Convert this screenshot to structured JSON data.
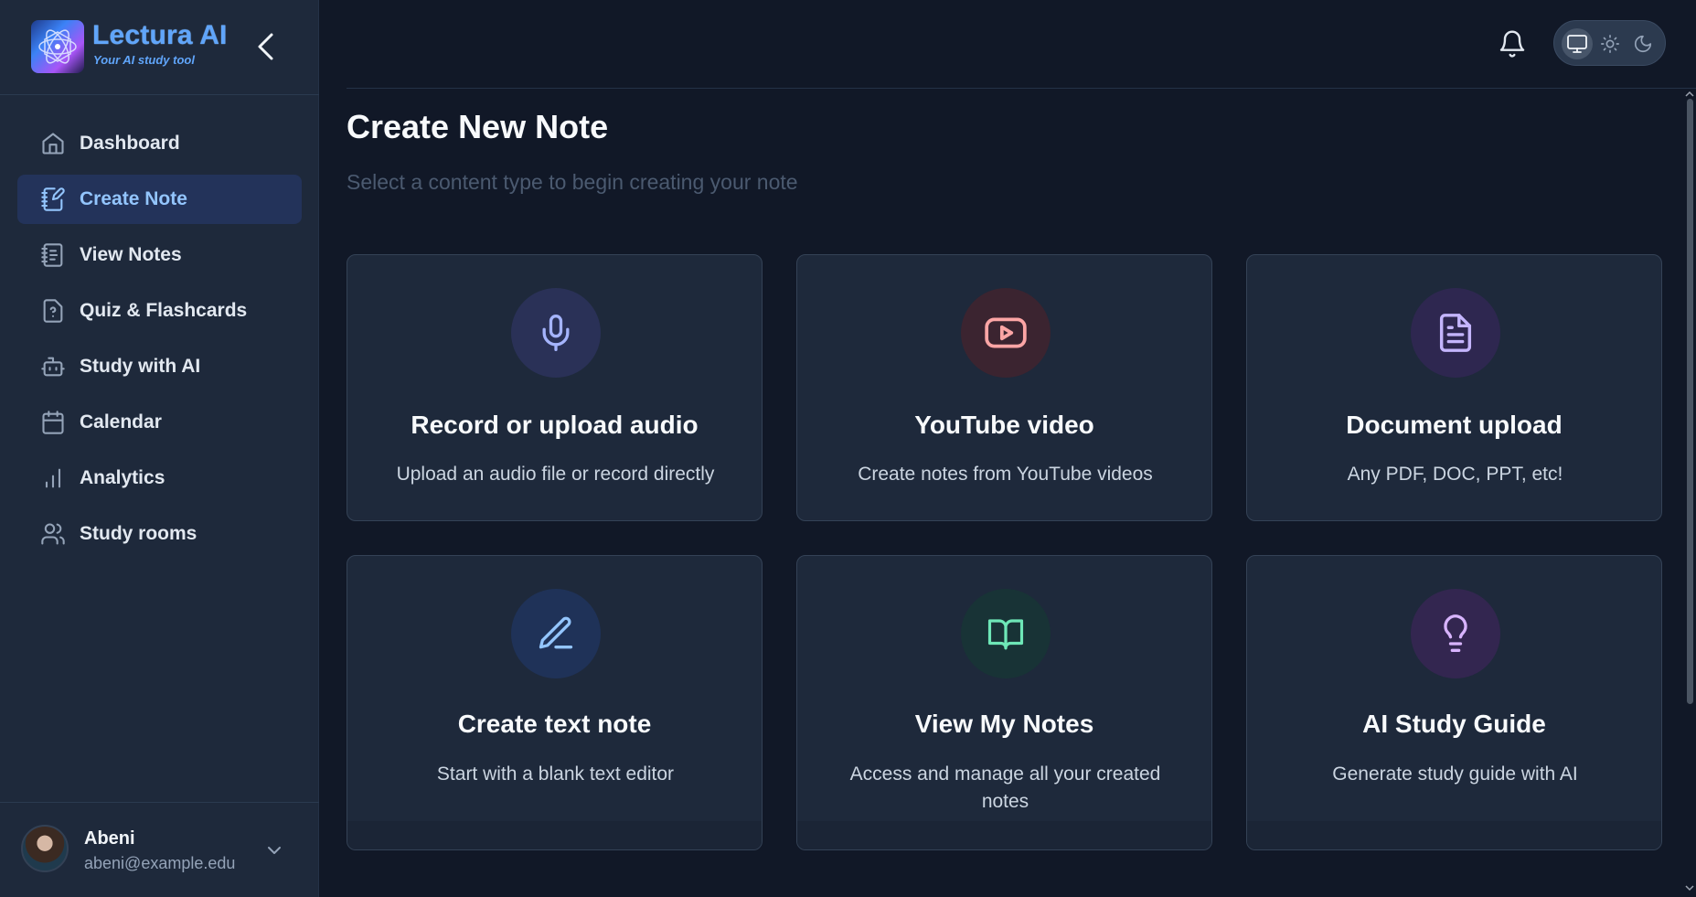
{
  "brand": {
    "name": "Lectura AI",
    "tagline": "Your AI study tool",
    "logo_icon": "atom-orb-logo",
    "accent": "#60a5fa"
  },
  "sidebar": {
    "collapse_icon": "chevron-left-icon",
    "items": [
      {
        "label": "Dashboard",
        "icon": "home-icon",
        "active": false
      },
      {
        "label": "Create Note",
        "icon": "notebook-pen-icon",
        "active": true
      },
      {
        "label": "View Notes",
        "icon": "notebook-text-icon",
        "active": false
      },
      {
        "label": "Quiz & Flashcards",
        "icon": "file-question-icon",
        "active": false
      },
      {
        "label": "Study with AI",
        "icon": "bot-icon",
        "active": false
      },
      {
        "label": "Calendar",
        "icon": "calendar-icon",
        "active": false
      },
      {
        "label": "Analytics",
        "icon": "bar-chart-icon",
        "active": false
      },
      {
        "label": "Study rooms",
        "icon": "users-icon",
        "active": false
      }
    ]
  },
  "user": {
    "name": "Abeni",
    "email": "abeni@example.edu"
  },
  "header": {
    "notification_icon": "bell-icon",
    "theme_options": [
      "monitor-icon",
      "sun-icon",
      "moon-icon"
    ],
    "theme_selected": "monitor-icon"
  },
  "main": {
    "title": "Create New Note",
    "subtitle": "Select a content type to begin creating your note",
    "cards": [
      {
        "title": "Record or upload audio",
        "description": "Upload an audio file or record directly",
        "icon": "microphone-icon",
        "icon_color": "#a5b4fc",
        "circle_color": "#2a3157"
      },
      {
        "title": "YouTube video",
        "description": "Create notes from YouTube videos",
        "icon": "youtube-icon",
        "icon_color": "#fca5a5",
        "circle_color": "#3b2430"
      },
      {
        "title": "Document upload",
        "description": "Any PDF, DOC, PPT, etc!",
        "icon": "document-icon",
        "icon_color": "#c4b5fd",
        "circle_color": "#2e2750"
      },
      {
        "title": "Create text note",
        "description": "Start with a blank text editor",
        "icon": "pen-line-icon",
        "icon_color": "#93c5fd",
        "circle_color": "#1f3258"
      },
      {
        "title": "View My Notes",
        "description": "Access and manage all your created notes",
        "icon": "book-open-icon",
        "icon_color": "#6ee7b7",
        "circle_color": "#183336"
      },
      {
        "title": "AI Study Guide",
        "description": "Generate study guide with AI",
        "icon": "lightbulb-icon",
        "icon_color": "#d8b4fe",
        "circle_color": "#332650"
      }
    ]
  }
}
